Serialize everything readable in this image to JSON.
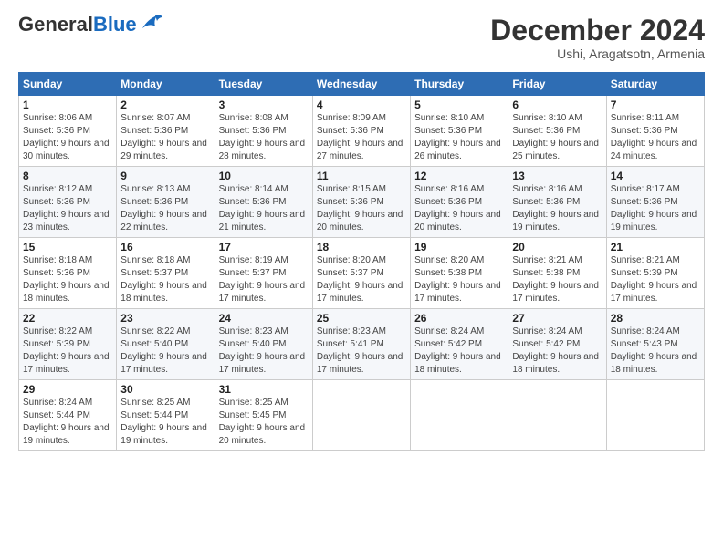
{
  "header": {
    "logo_general": "General",
    "logo_blue": "Blue",
    "main_title": "December 2024",
    "sub_title": "Ushi, Aragatsotn, Armenia"
  },
  "weekdays": [
    "Sunday",
    "Monday",
    "Tuesday",
    "Wednesday",
    "Thursday",
    "Friday",
    "Saturday"
  ],
  "weeks": [
    [
      {
        "day": "1",
        "sunrise": "8:06 AM",
        "sunset": "5:36 PM",
        "daylight": "9 hours and 30 minutes."
      },
      {
        "day": "2",
        "sunrise": "8:07 AM",
        "sunset": "5:36 PM",
        "daylight": "9 hours and 29 minutes."
      },
      {
        "day": "3",
        "sunrise": "8:08 AM",
        "sunset": "5:36 PM",
        "daylight": "9 hours and 28 minutes."
      },
      {
        "day": "4",
        "sunrise": "8:09 AM",
        "sunset": "5:36 PM",
        "daylight": "9 hours and 27 minutes."
      },
      {
        "day": "5",
        "sunrise": "8:10 AM",
        "sunset": "5:36 PM",
        "daylight": "9 hours and 26 minutes."
      },
      {
        "day": "6",
        "sunrise": "8:10 AM",
        "sunset": "5:36 PM",
        "daylight": "9 hours and 25 minutes."
      },
      {
        "day": "7",
        "sunrise": "8:11 AM",
        "sunset": "5:36 PM",
        "daylight": "9 hours and 24 minutes."
      }
    ],
    [
      {
        "day": "8",
        "sunrise": "8:12 AM",
        "sunset": "5:36 PM",
        "daylight": "9 hours and 23 minutes."
      },
      {
        "day": "9",
        "sunrise": "8:13 AM",
        "sunset": "5:36 PM",
        "daylight": "9 hours and 22 minutes."
      },
      {
        "day": "10",
        "sunrise": "8:14 AM",
        "sunset": "5:36 PM",
        "daylight": "9 hours and 21 minutes."
      },
      {
        "day": "11",
        "sunrise": "8:15 AM",
        "sunset": "5:36 PM",
        "daylight": "9 hours and 20 minutes."
      },
      {
        "day": "12",
        "sunrise": "8:16 AM",
        "sunset": "5:36 PM",
        "daylight": "9 hours and 20 minutes."
      },
      {
        "day": "13",
        "sunrise": "8:16 AM",
        "sunset": "5:36 PM",
        "daylight": "9 hours and 19 minutes."
      },
      {
        "day": "14",
        "sunrise": "8:17 AM",
        "sunset": "5:36 PM",
        "daylight": "9 hours and 19 minutes."
      }
    ],
    [
      {
        "day": "15",
        "sunrise": "8:18 AM",
        "sunset": "5:36 PM",
        "daylight": "9 hours and 18 minutes."
      },
      {
        "day": "16",
        "sunrise": "8:18 AM",
        "sunset": "5:37 PM",
        "daylight": "9 hours and 18 minutes."
      },
      {
        "day": "17",
        "sunrise": "8:19 AM",
        "sunset": "5:37 PM",
        "daylight": "9 hours and 17 minutes."
      },
      {
        "day": "18",
        "sunrise": "8:20 AM",
        "sunset": "5:37 PM",
        "daylight": "9 hours and 17 minutes."
      },
      {
        "day": "19",
        "sunrise": "8:20 AM",
        "sunset": "5:38 PM",
        "daylight": "9 hours and 17 minutes."
      },
      {
        "day": "20",
        "sunrise": "8:21 AM",
        "sunset": "5:38 PM",
        "daylight": "9 hours and 17 minutes."
      },
      {
        "day": "21",
        "sunrise": "8:21 AM",
        "sunset": "5:39 PM",
        "daylight": "9 hours and 17 minutes."
      }
    ],
    [
      {
        "day": "22",
        "sunrise": "8:22 AM",
        "sunset": "5:39 PM",
        "daylight": "9 hours and 17 minutes."
      },
      {
        "day": "23",
        "sunrise": "8:22 AM",
        "sunset": "5:40 PM",
        "daylight": "9 hours and 17 minutes."
      },
      {
        "day": "24",
        "sunrise": "8:23 AM",
        "sunset": "5:40 PM",
        "daylight": "9 hours and 17 minutes."
      },
      {
        "day": "25",
        "sunrise": "8:23 AM",
        "sunset": "5:41 PM",
        "daylight": "9 hours and 17 minutes."
      },
      {
        "day": "26",
        "sunrise": "8:24 AM",
        "sunset": "5:42 PM",
        "daylight": "9 hours and 18 minutes."
      },
      {
        "day": "27",
        "sunrise": "8:24 AM",
        "sunset": "5:42 PM",
        "daylight": "9 hours and 18 minutes."
      },
      {
        "day": "28",
        "sunrise": "8:24 AM",
        "sunset": "5:43 PM",
        "daylight": "9 hours and 18 minutes."
      }
    ],
    [
      {
        "day": "29",
        "sunrise": "8:24 AM",
        "sunset": "5:44 PM",
        "daylight": "9 hours and 19 minutes."
      },
      {
        "day": "30",
        "sunrise": "8:25 AM",
        "sunset": "5:44 PM",
        "daylight": "9 hours and 19 minutes."
      },
      {
        "day": "31",
        "sunrise": "8:25 AM",
        "sunset": "5:45 PM",
        "daylight": "9 hours and 20 minutes."
      },
      null,
      null,
      null,
      null
    ]
  ]
}
